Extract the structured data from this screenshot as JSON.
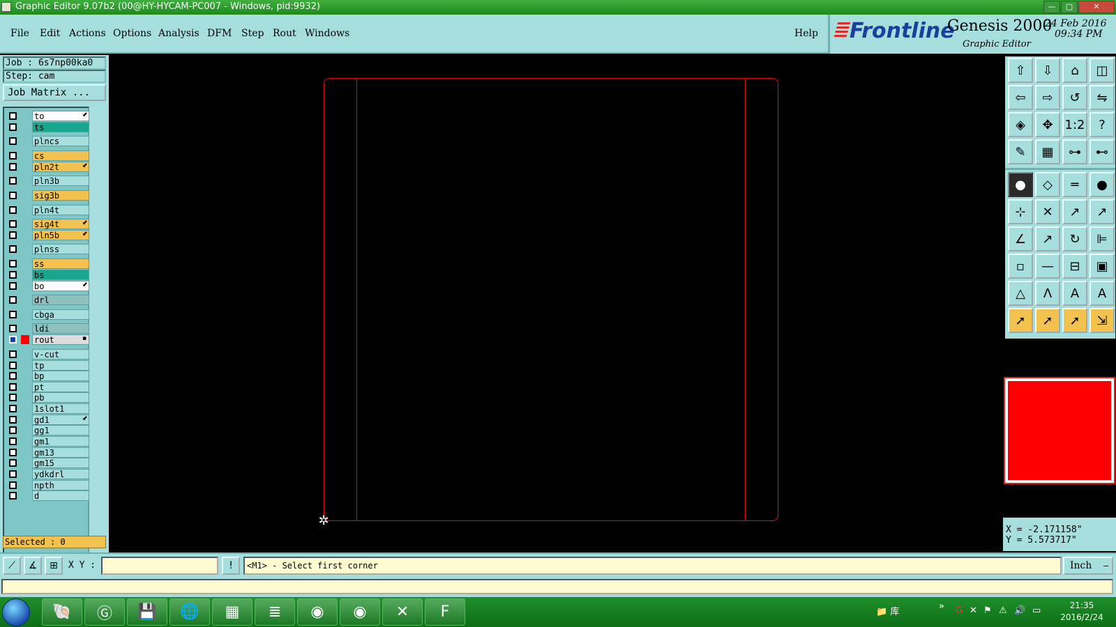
{
  "window": {
    "title": "Graphic Editor 9.07b2 (00@HY-HYCAM-PC007 - Windows, pid:9932)",
    "min_label": "—",
    "max_label": "▢",
    "close_label": "✕"
  },
  "menu": {
    "items": [
      "File",
      "Edit",
      "Actions",
      "Options",
      "Analysis",
      "DFM",
      "Step",
      "Rout",
      "Windows"
    ],
    "help": "Help"
  },
  "brand": {
    "logo": "Frontline",
    "product": "Genesis 2000",
    "subtitle": "Graphic Editor",
    "date": "24 Feb 2016",
    "time": "09:34 PM"
  },
  "job": {
    "job_label": "Job : 6s7np00ka0",
    "step_label": "Step: cam",
    "matrix_button": "Job Matrix ..."
  },
  "layers": [
    {
      "name": "to",
      "color": "#ffffff",
      "flag": "⬋",
      "active": false
    },
    {
      "name": "ts",
      "color": "#1aa58f",
      "flag": "",
      "active": false
    },
    {
      "name": "plncs",
      "color": "#a6dede",
      "flag": "",
      "active": false
    },
    {
      "name": "cs",
      "color": "#f2c14e",
      "flag": "",
      "active": false
    },
    {
      "name": "pln2t",
      "color": "#f2c14e",
      "flag": "⬋",
      "active": false
    },
    {
      "name": "pln3b",
      "color": "#a6dede",
      "flag": "",
      "active": false
    },
    {
      "name": "sig3b",
      "color": "#f2c14e",
      "flag": "",
      "active": false
    },
    {
      "name": "pln4t",
      "color": "#a6dede",
      "flag": "",
      "active": false
    },
    {
      "name": "sig4t",
      "color": "#f2c14e",
      "flag": "⬋",
      "active": false
    },
    {
      "name": "pln5b",
      "color": "#f2c14e",
      "flag": "⬋",
      "active": false
    },
    {
      "name": "plnss",
      "color": "#a6dede",
      "flag": "",
      "active": false
    },
    {
      "name": "ss",
      "color": "#f2c14e",
      "flag": "",
      "active": false
    },
    {
      "name": "bs",
      "color": "#1aa58f",
      "flag": "",
      "active": false
    },
    {
      "name": "bo",
      "color": "#ffffff",
      "flag": "⬋",
      "active": false
    },
    {
      "name": "drl",
      "color": "#8fbfbf",
      "flag": "",
      "active": false
    },
    {
      "name": "cbga",
      "color": "#a6dede",
      "flag": "",
      "active": false
    },
    {
      "name": "ldi",
      "color": "#8fbfbf",
      "flag": "",
      "active": false
    },
    {
      "name": "rout",
      "color": "#dddddd",
      "flag": "▪",
      "active": true
    },
    {
      "name": "v-cut",
      "color": "#a6dede",
      "flag": "",
      "active": false
    },
    {
      "name": "tp",
      "color": "#a6dede",
      "flag": "",
      "active": false
    },
    {
      "name": "bp",
      "color": "#a6dede",
      "flag": "",
      "active": false
    },
    {
      "name": "pt",
      "color": "#a6dede",
      "flag": "",
      "active": false
    },
    {
      "name": "pb",
      "color": "#a6dede",
      "flag": "",
      "active": false
    },
    {
      "name": "1slot1",
      "color": "#a6dede",
      "flag": "",
      "active": false
    },
    {
      "name": "gd1",
      "color": "#a6dede",
      "flag": "⬋",
      "active": false
    },
    {
      "name": "gg1",
      "color": "#a6dede",
      "flag": "",
      "active": false
    },
    {
      "name": "gm1",
      "color": "#a6dede",
      "flag": "",
      "active": false
    },
    {
      "name": "gm13",
      "color": "#a6dede",
      "flag": "",
      "active": false
    },
    {
      "name": "gm15",
      "color": "#a6dede",
      "flag": "",
      "active": false
    },
    {
      "name": "ydkdrl",
      "color": "#a6dede",
      "flag": "",
      "active": false
    },
    {
      "name": "npth",
      "color": "#a6dede",
      "flag": "",
      "active": false
    },
    {
      "name": "d",
      "color": "#a6dede",
      "flag": "",
      "active": false
    }
  ],
  "selected": "Selected : 0",
  "coords": {
    "x": "X = -2.171158\"",
    "y": "Y = 5.573717\""
  },
  "bottom": {
    "xy_label": "X Y :",
    "xy_value": "",
    "exclaim": "!",
    "prompt": "<M1> - Select first corner",
    "units": "Inch"
  },
  "tools": [
    "⇧",
    "⇩",
    "⌂",
    "◫",
    "⇦",
    "⇨",
    "↺",
    "⇋",
    "◈",
    "✥",
    "1:2",
    "?",
    "✎",
    "▦",
    "⊶",
    "⊷",
    "●",
    "◇",
    "═",
    "●",
    "⊹",
    "✕",
    "↗",
    "↗",
    "∠",
    "↗",
    "↻",
    "⊫",
    "▫",
    "—",
    "⊟",
    "▣",
    "△",
    "Λ",
    "A",
    "A",
    "➚",
    "➚",
    "➚",
    "⇲"
  ],
  "taskbar": {
    "apps": [
      "🐚",
      "Ⓖ",
      "💾",
      "🌐",
      "▦",
      "≣",
      "◉",
      "◉",
      "✕",
      "F"
    ],
    "tray_folder": "库",
    "time": "21:35",
    "date": "2016/2/24"
  }
}
